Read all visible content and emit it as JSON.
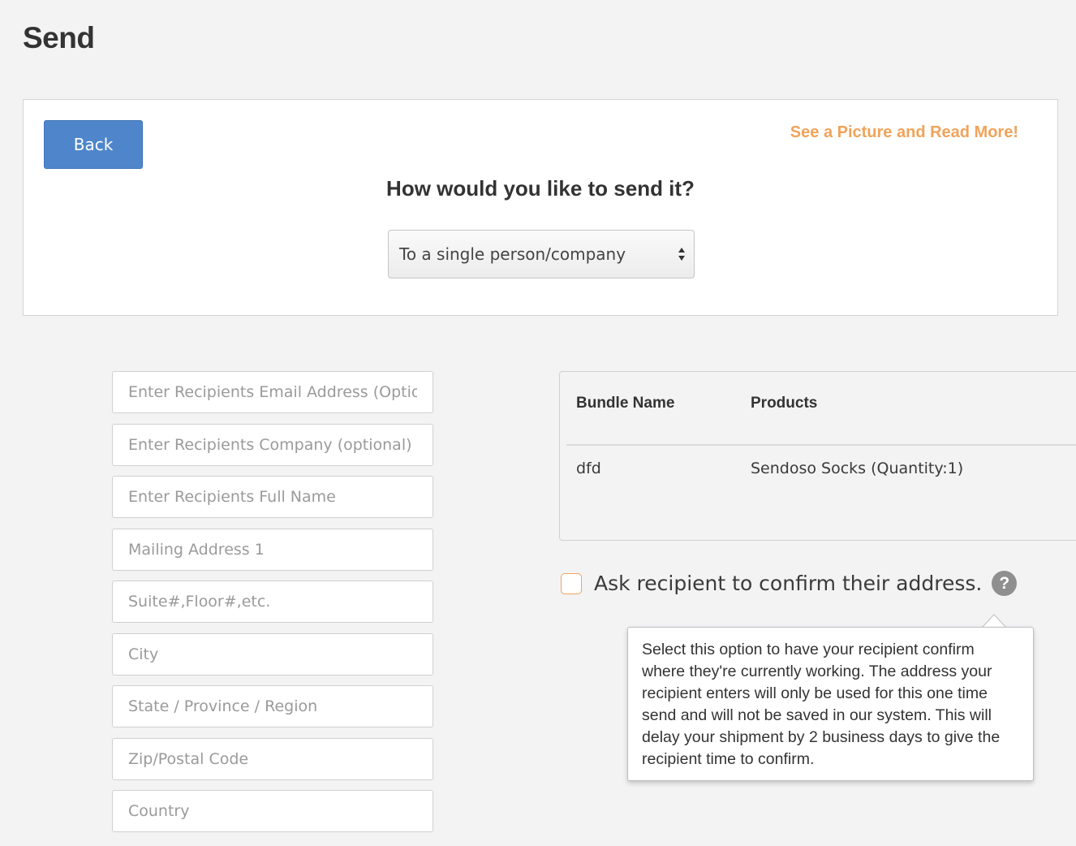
{
  "page": {
    "title": "Send"
  },
  "top_panel": {
    "back_label": "Back",
    "see_more_label": "See a Picture and Read More!",
    "question": "How would you like to send it?",
    "send_method": {
      "selected": "To a single person/company"
    }
  },
  "form": {
    "email_placeholder": "Enter Recipients Email Address (Optional)",
    "company_placeholder": "Enter Recipients Company (optional)",
    "fullname_placeholder": "Enter Recipients Full Name",
    "address1_placeholder": "Mailing Address 1",
    "address2_placeholder": "Suite#,Floor#,etc.",
    "city_placeholder": "City",
    "state_placeholder": "State / Province / Region",
    "zip_placeholder": "Zip/Postal Code",
    "country_placeholder": "Country"
  },
  "bundle_table": {
    "headers": {
      "bundle_name": "Bundle Name",
      "products": "Products"
    },
    "rows": [
      {
        "bundle_name": "dfd",
        "products": "Sendoso Socks (Quantity:1)"
      }
    ]
  },
  "confirm_address": {
    "label": "Ask recipient to confirm their address.",
    "checked": false,
    "help_icon_glyph": "?",
    "tooltip": "Select this option to have your recipient confirm where they're currently working. The address your recipient enters will only be used for this one time send and will not be saved in our system. This will delay your shipment by 2 business days to give the recipient time to confirm."
  },
  "colors": {
    "background": "#f3f3f4",
    "primary_button": "#4f86cb",
    "accent_orange": "#f0a35a",
    "help_icon": "#8f8f8f"
  },
  "icons": {
    "select_arrows": "select-arrows-icon",
    "help": "question-circle-icon"
  }
}
